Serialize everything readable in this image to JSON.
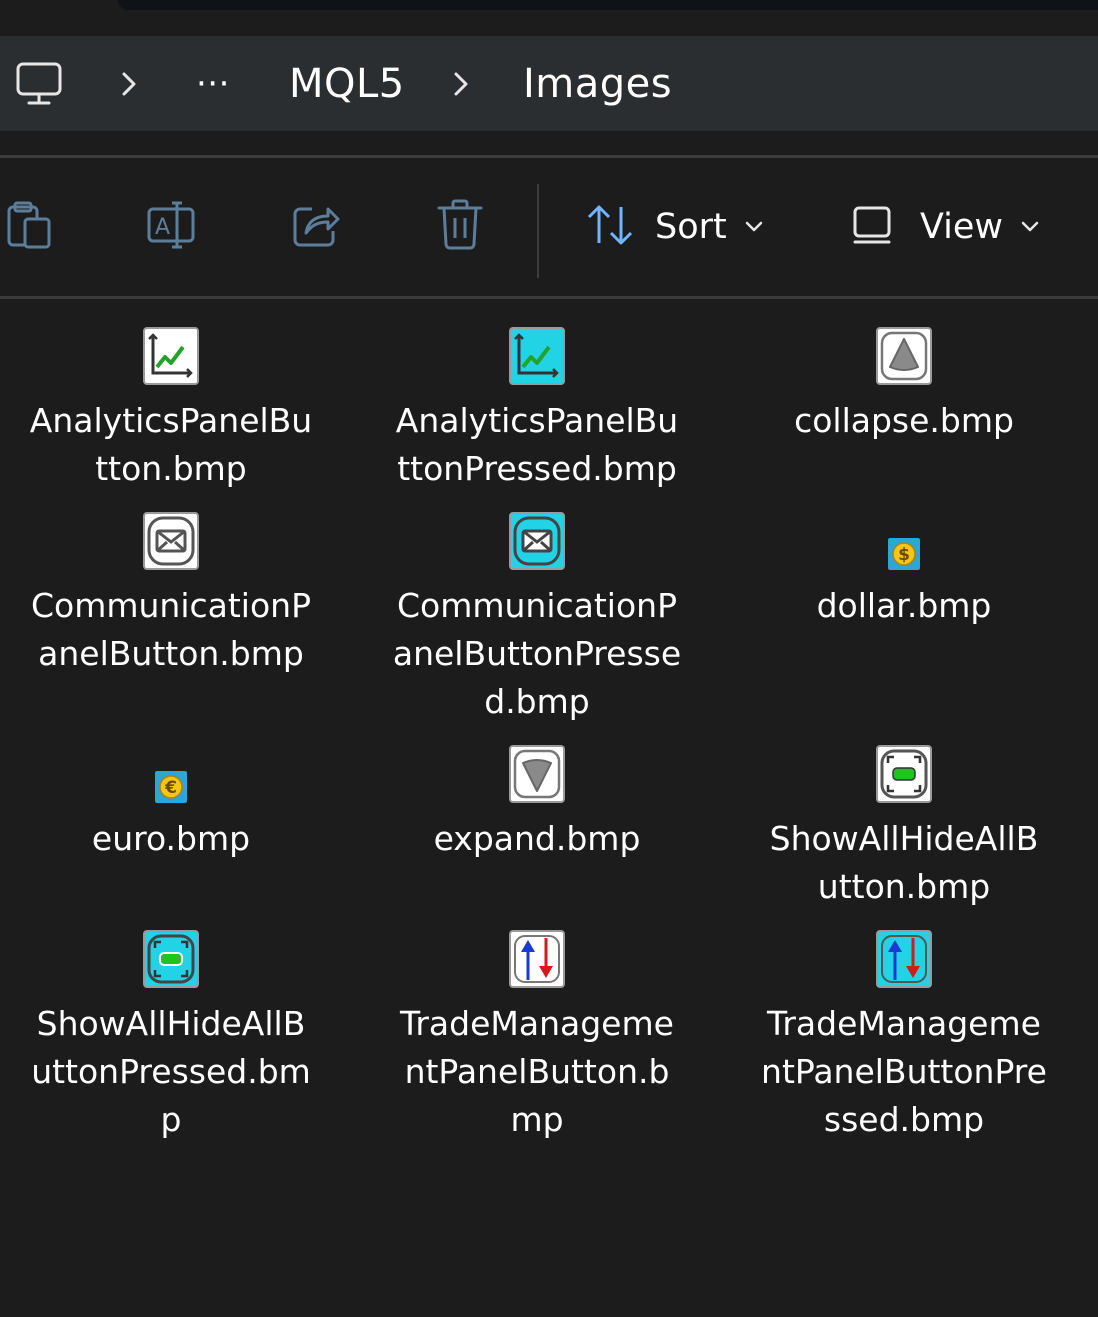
{
  "breadcrumb": {
    "more_label": "···",
    "items": [
      "MQL5",
      "Images"
    ]
  },
  "toolbar": {
    "sort_label": "Sort",
    "view_label": "View"
  },
  "files": [
    {
      "name": "AnalyticsPanelBu\ntton.bmp",
      "icon": "chart-icon",
      "bg": "#ffffff"
    },
    {
      "name": "AnalyticsPanelBu\nttonPressed.bmp",
      "icon": "chart-icon",
      "bg": "#22d3e6"
    },
    {
      "name": "collapse.bmp",
      "icon": "triangle-up-icon",
      "bg": "#ffffff"
    },
    {
      "name": "CommunicationP\nanelButton.bmp",
      "icon": "envelope-icon",
      "bg": "#ffffff"
    },
    {
      "name": "CommunicationP\nanelButtonPresse\nd.bmp",
      "icon": "envelope-icon",
      "bg": "#22d3e6"
    },
    {
      "name": "dollar.bmp",
      "icon": "dollar-icon",
      "bg": "#2aa7d6"
    },
    {
      "name": "euro.bmp",
      "icon": "euro-icon",
      "bg": "#2aa7d6"
    },
    {
      "name": "expand.bmp",
      "icon": "triangle-down-icon",
      "bg": "#ffffff"
    },
    {
      "name": "ShowAllHideAllB\nutton.bmp",
      "icon": "show-hide-icon",
      "bg": "#ffffff"
    },
    {
      "name": "ShowAllHideAllB\nuttonPressed.bm\np",
      "icon": "show-hide-icon",
      "bg": "#22d3e6"
    },
    {
      "name": "TradeManageme\nntPanelButton.b\nmp",
      "icon": "up-down-arrows-icon",
      "bg": "#ffffff"
    },
    {
      "name": "TradeManageme\nntPanelButtonPre\nssed.bmp",
      "icon": "up-down-arrows-icon",
      "bg": "#22d3e6"
    }
  ]
}
